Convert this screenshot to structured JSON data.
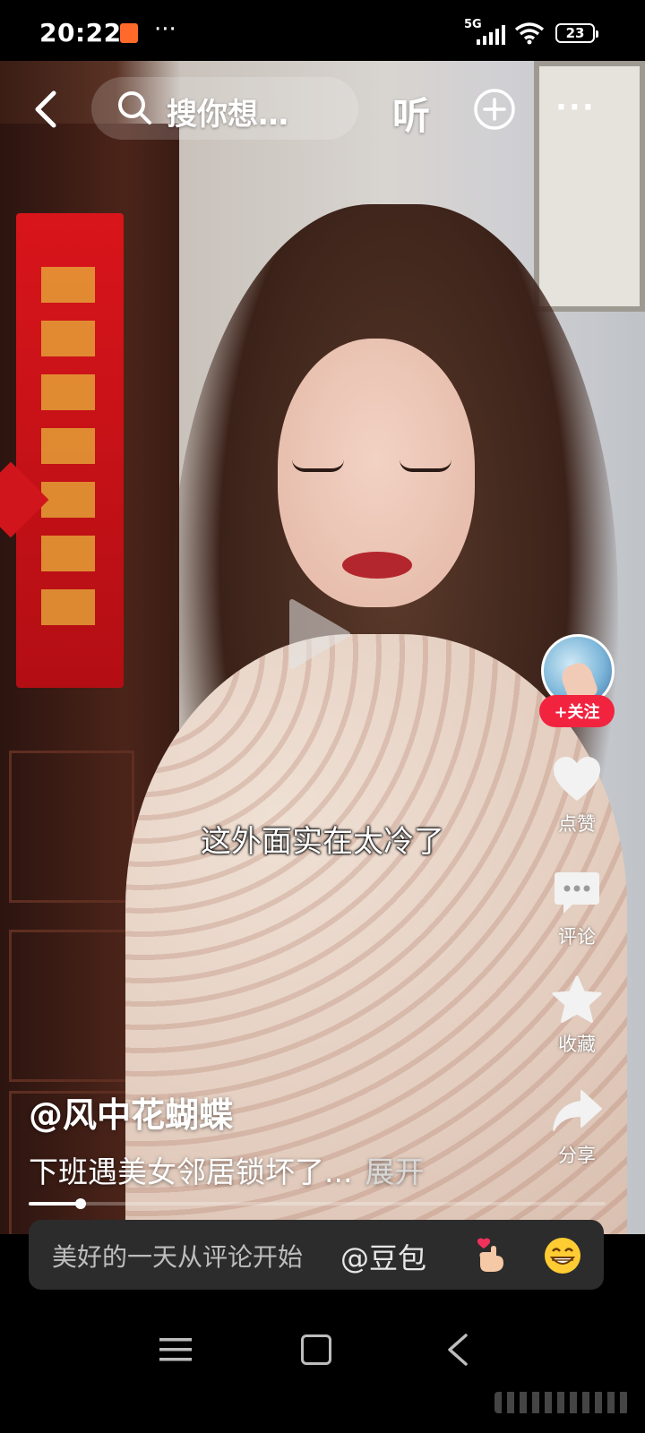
{
  "status_bar": {
    "time": "20:22",
    "dots": "···",
    "network": "5G",
    "battery": "23"
  },
  "top_bar": {
    "search_placeholder": "搜你想…",
    "listen_label": "听",
    "more_label": "···"
  },
  "video": {
    "subtitle": "这外面实在太冷了",
    "progress_fraction": 0.09
  },
  "actions": {
    "follow_label": "+关注",
    "like_label": "点赞",
    "comment_label": "评论",
    "favorite_label": "收藏",
    "share_label": "分享"
  },
  "post": {
    "author": "@风中花蝴蝶",
    "description": "下班遇美女邻居锁坏了...",
    "expand_label": "展开"
  },
  "comment_bar": {
    "placeholder": "美好的一天从评论开始",
    "mention": "@豆包"
  },
  "colors": {
    "accent": "#f2233f",
    "comment_bar_bg": "#2c2c2c",
    "notification": "#ff6a2a"
  },
  "icons": [
    "back-icon",
    "search-icon",
    "add-icon",
    "more-icon",
    "play-icon",
    "heart-icon",
    "comment-icon",
    "star-icon",
    "share-icon",
    "heart-hand-icon",
    "grin-icon",
    "menu-icon",
    "home-icon",
    "nav-back-icon"
  ]
}
